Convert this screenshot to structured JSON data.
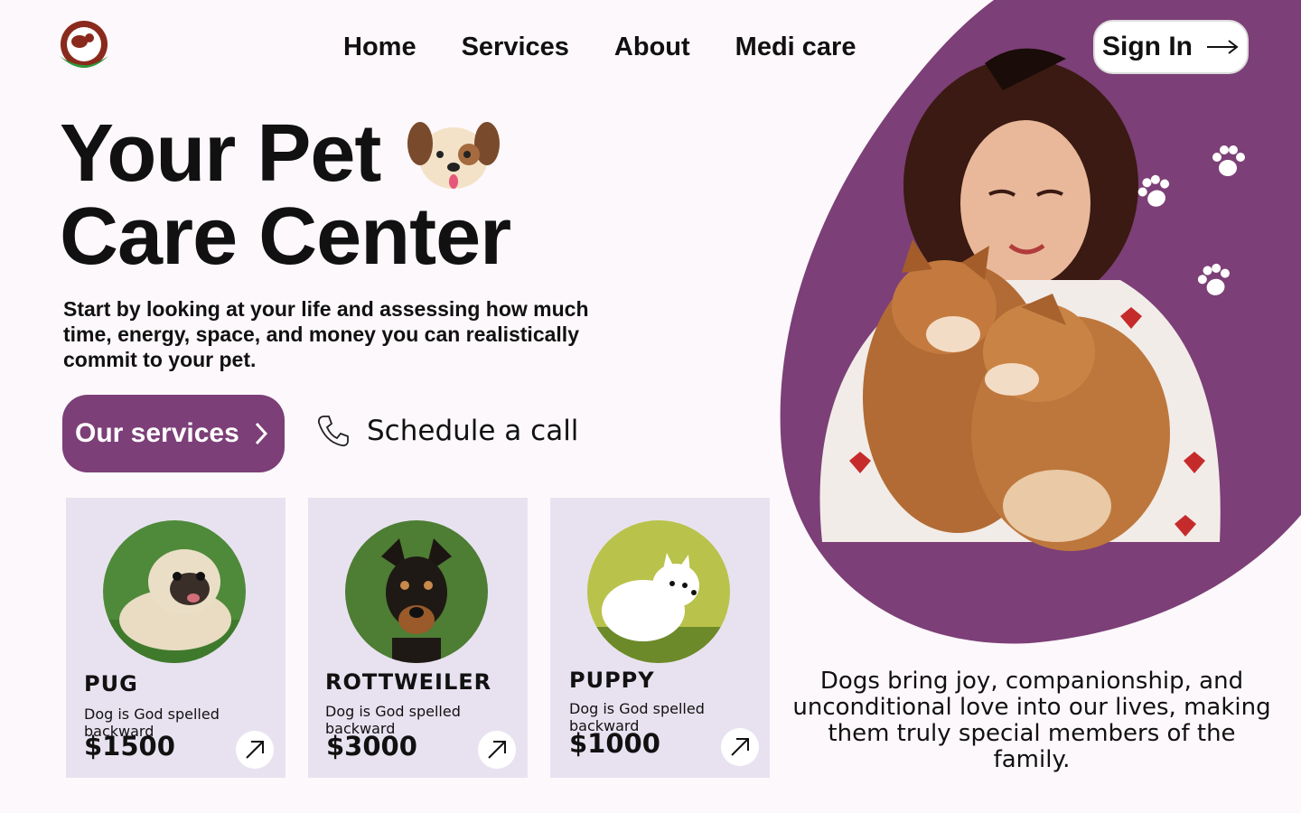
{
  "nav": {
    "items": [
      "Home",
      "Services",
      "About",
      "Medi care"
    ],
    "sign_in": "Sign In"
  },
  "hero": {
    "title_line1": "Your Pet",
    "title_line2": "Care Center",
    "description": "Start by looking at your life and assessing how much time, energy, space, and money you can realistically commit to your pet.",
    "primary_button": "Our services",
    "secondary_button": "Schedule a call"
  },
  "cards": [
    {
      "name": "PUG",
      "tagline": "Dog is God spelled backward",
      "price": "$1500"
    },
    {
      "name": "ROTTWEILER",
      "tagline": "Dog is God spelled backward",
      "price": "$3000"
    },
    {
      "name": "PUPPY",
      "tagline": "Dog is God spelled backward",
      "price": "$1000"
    }
  ],
  "quote": "Dogs bring joy, companionship, and unconditional love into our lives, making them truly special members of the family.",
  "colors": {
    "accent": "#7c3f77",
    "card_bg": "#e8e2f0",
    "page_bg": "#fdf8fb"
  },
  "icons": [
    "logo-icon",
    "dog-face-icon",
    "chevron-right-icon",
    "phone-icon",
    "arrow-up-right-icon",
    "arrow-right-icon",
    "paw-icon"
  ]
}
